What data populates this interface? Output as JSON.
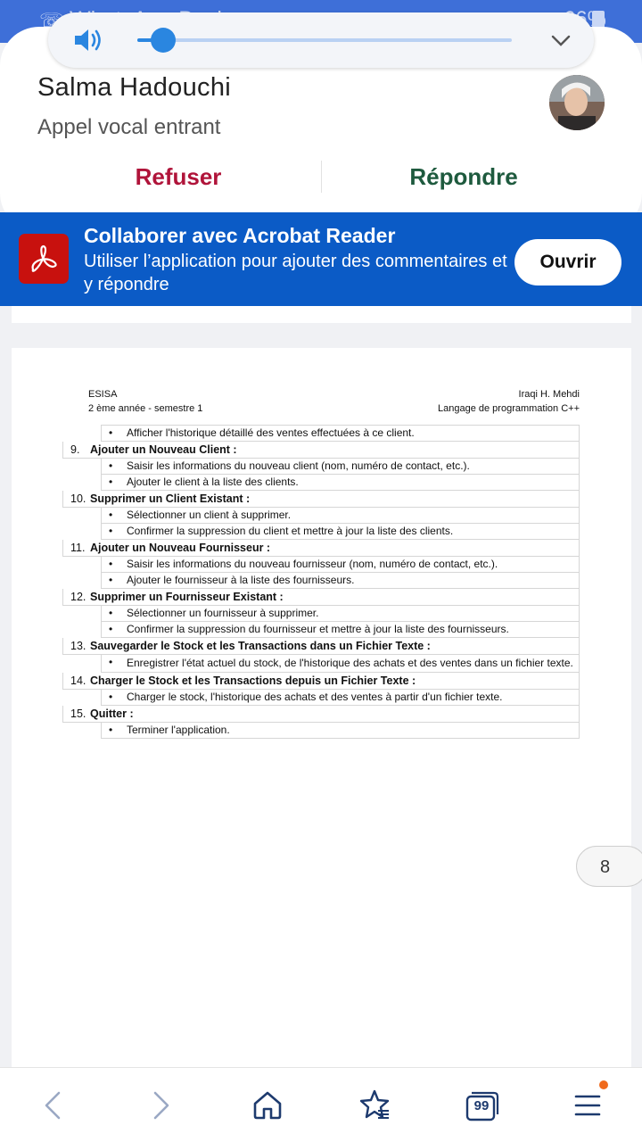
{
  "status_bar": {
    "app_name": "WhatsApp Business",
    "battery": "66%"
  },
  "call": {
    "caller_name": "Salma Hadouchi",
    "subtitle": "Appel vocal entrant",
    "decline_label": "Refuser",
    "answer_label": "Répondre"
  },
  "volume": {
    "level": 0.07
  },
  "banner": {
    "title": "Collaborer avec Acrobat Reader",
    "text": "Utiliser l’application pour ajouter des commentaires et y répondre",
    "open_label": "Ouvrir"
  },
  "document": {
    "header_left": [
      "ESISA",
      "2 ème année - semestre 1"
    ],
    "header_right": [
      "Iraqi H. Mehdi",
      "Langage de programmation C++"
    ],
    "first_bullet": "Afficher l'historique détaillé des ventes effectuées à ce client.",
    "items": [
      {
        "num": "9.",
        "title": "Ajouter un Nouveau Client :",
        "bullets": [
          "Saisir les informations du nouveau client (nom, numéro de contact, etc.).",
          "Ajouter le client à la liste des clients."
        ]
      },
      {
        "num": "10.",
        "title": "Supprimer un Client Existant :",
        "bullets": [
          "Sélectionner un client à supprimer.",
          "Confirmer la suppression du client et mettre à jour la liste des clients."
        ]
      },
      {
        "num": "11.",
        "title": "Ajouter un Nouveau Fournisseur :",
        "bullets": [
          "Saisir les informations du nouveau fournisseur (nom, numéro de contact, etc.).",
          "Ajouter le fournisseur à la liste des fournisseurs."
        ]
      },
      {
        "num": "12.",
        "title": "Supprimer un Fournisseur Existant :",
        "bullets": [
          "Sélectionner un fournisseur à supprimer.",
          "Confirmer la suppression du fournisseur et mettre à jour la liste des fournisseurs."
        ]
      },
      {
        "num": "13.",
        "title": "Sauvegarder le Stock et les Transactions dans un Fichier Texte :",
        "bullets": [
          "Enregistrer l'état actuel du stock, de l'historique des achats et des ventes dans un fichier texte."
        ]
      },
      {
        "num": "14.",
        "title": "Charger le Stock et les Transactions depuis un Fichier Texte :",
        "bullets": [
          "Charger le stock, l'historique des achats et des ventes à partir d'un fichier texte."
        ]
      },
      {
        "num": "15.",
        "title": "Quitter :",
        "bullets": [
          "Terminer l'application."
        ]
      }
    ],
    "page_number": "8"
  },
  "nav": {
    "tabs_count": "99"
  },
  "colors": {
    "accent_blue": "#0b5bc6",
    "decline_red": "#b0143a",
    "answer_green": "#1e5a3e",
    "acrobat_red": "#c8110e"
  }
}
